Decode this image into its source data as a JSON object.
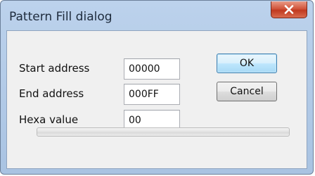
{
  "window": {
    "title": "Pattern Fill dialog",
    "close_icon": "close-icon"
  },
  "form": {
    "start_address": {
      "label": "Start address",
      "value": "00000"
    },
    "end_address": {
      "label": "End address",
      "value": "000FF"
    },
    "hexa_value": {
      "label": "Hexa value",
      "value": "00"
    }
  },
  "buttons": {
    "ok_label": "OK",
    "cancel_label": "Cancel"
  },
  "progress": {
    "fraction": 0
  },
  "colors": {
    "frame": "#b4cbe8",
    "client": "#f0f0f0",
    "close": "#c84a31",
    "default_button": "#bee6fd"
  }
}
